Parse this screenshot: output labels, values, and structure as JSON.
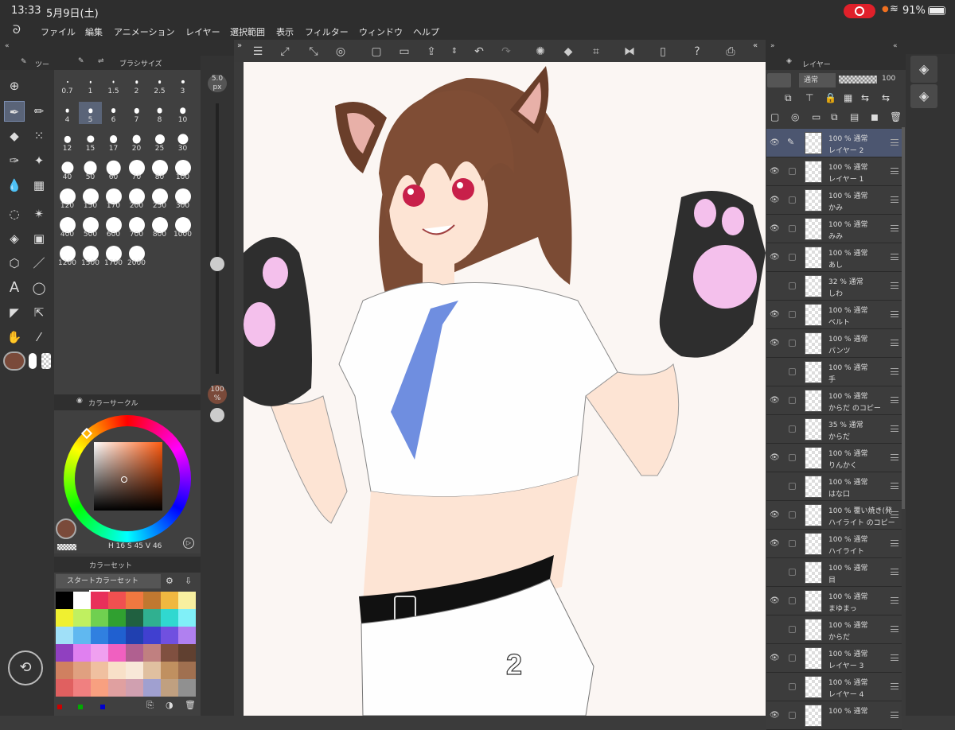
{
  "status": {
    "time": "13:33",
    "date": "5月9日(土)",
    "battery": "91%"
  },
  "menu": [
    "ファイル",
    "編集",
    "アニメーション",
    "レイヤー",
    "選択範囲",
    "表示",
    "フィルター",
    "ウィンドウ",
    "ヘルプ"
  ],
  "tool_panel_tab": "ツー",
  "brush_panel": {
    "title": "ブラシサイズ",
    "sizes": [
      "0.7",
      "1",
      "1.5",
      "2",
      "2.5",
      "3",
      "4",
      "5",
      "6",
      "7",
      "8",
      "10",
      "12",
      "15",
      "17",
      "20",
      "25",
      "30",
      "40",
      "50",
      "60",
      "70",
      "80",
      "100",
      "120",
      "150",
      "170",
      "200",
      "250",
      "300",
      "400",
      "500",
      "600",
      "700",
      "800",
      "1000",
      "1200",
      "1500",
      "1700",
      "2000"
    ],
    "selected": "5"
  },
  "brush_size_readout": "5.0",
  "brush_size_unit": "px",
  "opacity_readout": "100",
  "opacity_unit": "%",
  "color_circle": {
    "title": "カラーサークル",
    "h_label": "H",
    "h": "16",
    "s_label": "S",
    "s": "45",
    "v_label": "V",
    "v": "46",
    "current_color": "#7a4a3a"
  },
  "color_set": {
    "title": "カラーセット",
    "selected_set": "スタートカラーセット",
    "colors": [
      "#000000",
      "#ffffff",
      "#e8305a",
      "#f05050",
      "#f07840",
      "#c07830",
      "#f0b840",
      "#f8f0a0",
      "#f0f030",
      "#c0f060",
      "#70d050",
      "#30a030",
      "#206040",
      "#30b090",
      "#30d8d0",
      "#80f0f8",
      "#a0e0f8",
      "#60b8f0",
      "#3080e0",
      "#2060d0",
      "#2040b0",
      "#4040d0",
      "#7050e0",
      "#b080f0",
      "#9040c0",
      "#e080f0",
      "#f0a0f0",
      "#f060c0",
      "#b06090",
      "#c08080",
      "#805040",
      "#604030",
      "#d08060",
      "#e0a080",
      "#f0c0a0",
      "#f8e0c8",
      "#f8e8d8",
      "#e0c0a0",
      "#c09060",
      "#a07050",
      "#e06060",
      "#f08080",
      "#f8a080",
      "#e0a0a0",
      "#d0a0b0",
      "#a0a0d0",
      "#c0a080",
      "#909090"
    ]
  },
  "layer_panel": {
    "title": "レイヤー",
    "blend": "通常",
    "opacity": "100",
    "layers": [
      {
        "pct": "100 % 通常",
        "name": "レイヤー 2"
      },
      {
        "pct": "100 % 通常",
        "name": "レイヤー 1"
      },
      {
        "pct": "100 % 通常",
        "name": "かみ"
      },
      {
        "pct": "100 % 通常",
        "name": "みみ"
      },
      {
        "pct": "100 % 通常",
        "name": "あし"
      },
      {
        "pct": "32 % 通常",
        "name": "しわ"
      },
      {
        "pct": "100 % 通常",
        "name": "ベルト"
      },
      {
        "pct": "100 % 通常",
        "name": "パンツ"
      },
      {
        "pct": "100 % 通常",
        "name": "手"
      },
      {
        "pct": "100 % 通常",
        "name": "からだ のコピー"
      },
      {
        "pct": "35 % 通常",
        "name": "からだ"
      },
      {
        "pct": "100 % 通常",
        "name": "りんかく"
      },
      {
        "pct": "100 % 通常",
        "name": "はな口"
      },
      {
        "pct": "100 % 覆い焼き(発",
        "name": "ハイライト のコピー"
      },
      {
        "pct": "100 % 通常",
        "name": "ハイライト"
      },
      {
        "pct": "100 % 通常",
        "name": "目"
      },
      {
        "pct": "100 % 通常",
        "name": "まゆまっ"
      },
      {
        "pct": "100 % 通常",
        "name": "からだ"
      },
      {
        "pct": "100 % 通常",
        "name": "レイヤー 3"
      },
      {
        "pct": "100 % 通常",
        "name": "レイヤー 4"
      },
      {
        "pct": "100 % 通常",
        "name": ""
      }
    ]
  },
  "canvas_number": "2"
}
